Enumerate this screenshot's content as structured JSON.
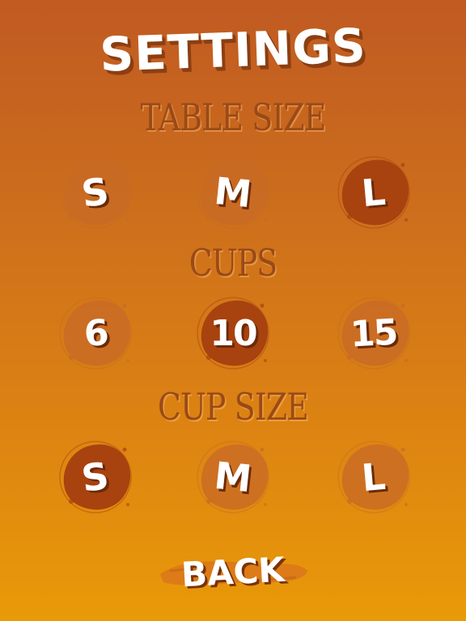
{
  "title": "SETTINGS",
  "sections": {
    "table_size": {
      "label": "TABLE SIZE",
      "options": [
        {
          "label": "S",
          "selected": false
        },
        {
          "label": "M",
          "selected": false
        },
        {
          "label": "L",
          "selected": true
        }
      ]
    },
    "cups": {
      "label": "CUPS",
      "options": [
        {
          "label": "6",
          "selected": false
        },
        {
          "label": "10",
          "selected": true
        },
        {
          "label": "15",
          "selected": false
        }
      ]
    },
    "cup_size": {
      "label": "CUP SIZE",
      "options": [
        {
          "label": "S",
          "selected": true
        },
        {
          "label": "M",
          "selected": false
        },
        {
          "label": "L",
          "selected": false
        }
      ]
    }
  },
  "back_label": "BACK",
  "colors": {
    "selected_blob": "#a8420f",
    "unselected_blob": "#c86a25",
    "label": "#9a4a18"
  }
}
